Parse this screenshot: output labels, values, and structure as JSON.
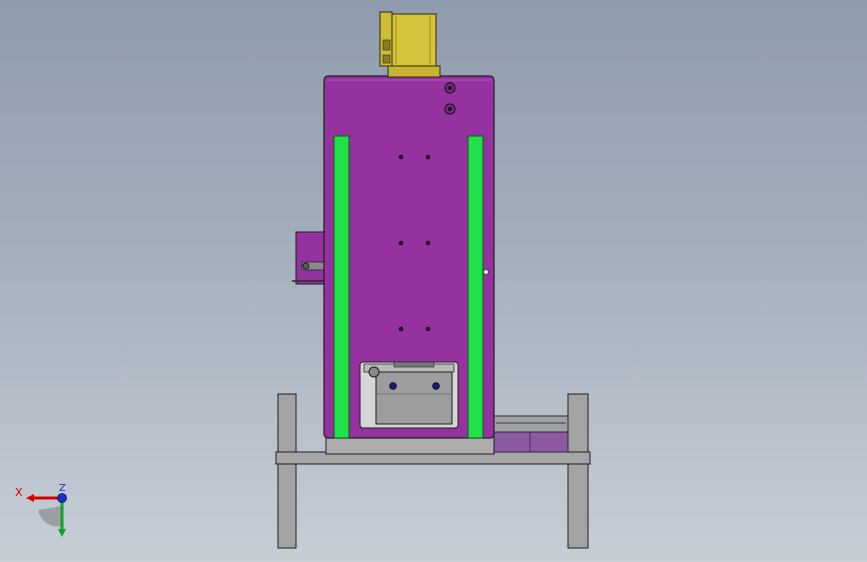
{
  "viewport": {
    "background_top": "#8f9cad",
    "background_bottom": "#c7ced6"
  },
  "model": {
    "colors": {
      "housing": "#9632a0",
      "rail": "#22e04a",
      "motor": "#d4c43a",
      "frame": "#a3a3a3",
      "carriage": "#9d9d9d",
      "slide": "#8d5aa2"
    }
  },
  "triad": {
    "x_label": "X",
    "z_label": "Z",
    "x_color": "#d40000",
    "y_color": "#13a12e",
    "z_color": "#1c2fc4"
  }
}
